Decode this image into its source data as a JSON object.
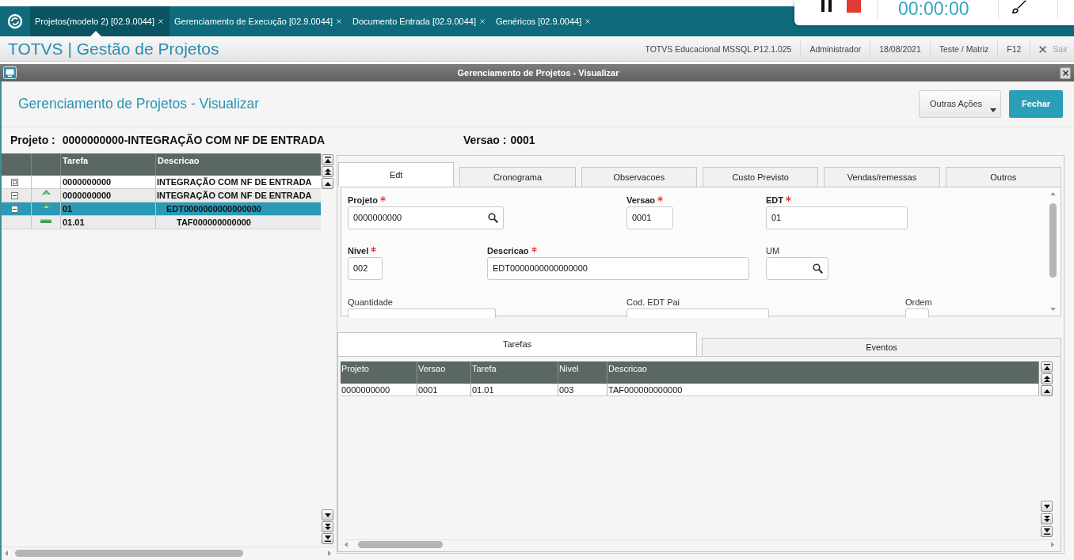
{
  "top_tabs": [
    {
      "label": "Projetos(modelo 2) [02.9.0044]",
      "selected": true
    },
    {
      "label": "Gerenciamento de Execução [02.9.0044]",
      "selected": false
    },
    {
      "label": "Documento Entrada [02.9.0044]",
      "selected": false
    },
    {
      "label": "Genéricos [02.9.0044]",
      "selected": false
    }
  ],
  "recorder": {
    "timer": "00:00:00"
  },
  "header": {
    "title": "TOTVS | Gestão de Projetos",
    "info": [
      "TOTVS Educacional MSSQL P12.1.025",
      "Administrador",
      "18/08/2021",
      "Teste / Matriz",
      "F12"
    ],
    "exit": "Sair"
  },
  "window": {
    "title": "Gerenciamento de Projetos - Visualizar"
  },
  "page": {
    "heading": "Gerenciamento de Projetos - Visualizar",
    "buttons": [
      {
        "kind": "menu",
        "label": "Outras Ações"
      },
      {
        "kind": "primary",
        "label": "Fechar"
      }
    ]
  },
  "summary": {
    "project_label": "Projeto :",
    "project": "0000000000-INTEGRAÇÃO COM NF DE ENTRADA",
    "version_label": "Versao :",
    "version": "0001"
  },
  "tree": {
    "columns": [
      "Tarefa",
      "Descricao"
    ],
    "rows": [
      {
        "kind": "project",
        "tarefa": "0000000000",
        "descricao": "INTEGRAÇÃO COM NF DE ENTRADA",
        "selected": false
      },
      {
        "kind": "edt",
        "tarefa": "0000000000",
        "descricao": "INTEGRAÇÃO COM NF DE ENTRADA",
        "selected": false,
        "expanded": true,
        "children": [
          {
            "kind": "edt",
            "tarefa": "01",
            "descricao": "EDT0000000000000000",
            "selected": true,
            "expanded": true,
            "children": [
              {
                "kind": "task",
                "tarefa": "01.01",
                "descricao": "TAF000000000000",
                "selected": false
              }
            ]
          }
        ]
      }
    ]
  },
  "edt_tabs": [
    {
      "label": "Edt",
      "selected": true
    },
    {
      "label": "Cronograma",
      "selected": false
    },
    {
      "label": "Observacoes",
      "selected": false
    },
    {
      "label": "Custo Previsto",
      "selected": false
    },
    {
      "label": "Vendas/remessas",
      "selected": false
    },
    {
      "label": "Outros",
      "selected": false
    }
  ],
  "edt_form": {
    "rows": [
      [
        {
          "label": "Projeto",
          "required": true,
          "value": "0000000000",
          "lookup": true
        },
        {
          "label": "Versao",
          "required": true,
          "value": "0001",
          "lookup": false
        },
        {
          "label": "EDT",
          "required": true,
          "value": "01",
          "lookup": false
        }
      ],
      [
        {
          "label": "Nivel",
          "required": true,
          "value": "002",
          "lookup": false
        },
        {
          "label": "Descricao",
          "required": true,
          "value": "EDT0000000000000000",
          "lookup": false
        },
        {
          "label": "UM",
          "required": false,
          "lookup": true
        }
      ],
      [
        {
          "label": "Quantidade",
          "required": false,
          "lookup": false
        },
        {
          "label": "Cod. EDT Pai",
          "required": false,
          "lookup": false
        },
        {
          "label": "Ordem",
          "required": false,
          "lookup": false
        }
      ]
    ]
  },
  "detail_tabs": [
    {
      "label": "Tarefas",
      "selected": true
    },
    {
      "label": "Eventos",
      "selected": false
    }
  ],
  "tasks_table": {
    "columns": [
      "Projeto",
      "Versao",
      "Tarefa",
      "Nivel",
      "Descricao"
    ],
    "rows": [
      [
        "0000000000",
        "0001",
        "01.01",
        "003",
        "TAF000000000000"
      ]
    ]
  }
}
